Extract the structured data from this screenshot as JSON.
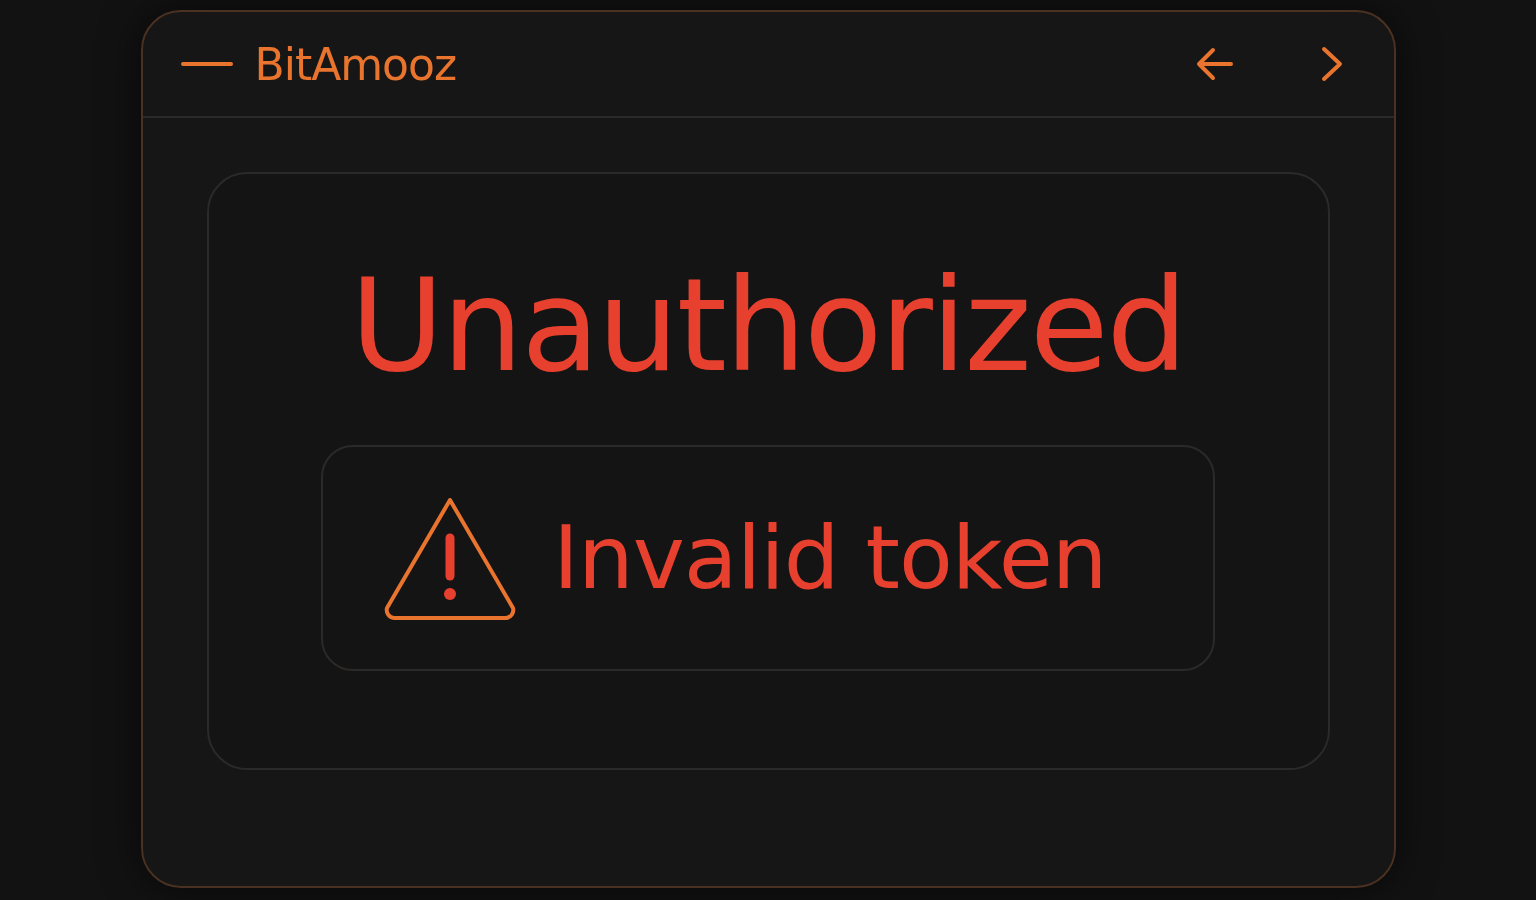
{
  "header": {
    "brand": "BitAmooz"
  },
  "error": {
    "title": "Unauthorized",
    "message": "Invalid token"
  }
}
